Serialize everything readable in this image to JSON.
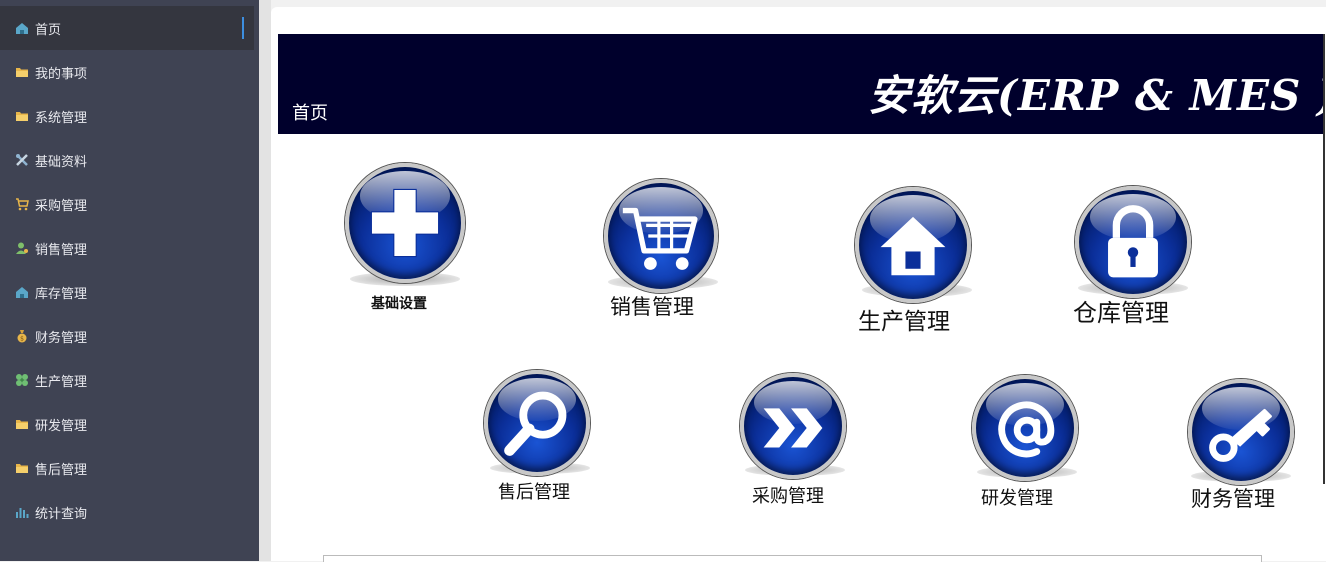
{
  "sidebar": {
    "items": [
      {
        "label": "首页",
        "icon": "home-icon",
        "active": true
      },
      {
        "label": "我的事项",
        "icon": "folder-icon"
      },
      {
        "label": "系统管理",
        "icon": "folder-icon"
      },
      {
        "label": "基础资料",
        "icon": "tools-icon"
      },
      {
        "label": "采购管理",
        "icon": "cart-icon"
      },
      {
        "label": "销售管理",
        "icon": "user-icon"
      },
      {
        "label": "库存管理",
        "icon": "home-icon"
      },
      {
        "label": "财务管理",
        "icon": "money-bag-icon"
      },
      {
        "label": "生产管理",
        "icon": "clover-icon"
      },
      {
        "label": "研发管理",
        "icon": "folder-icon"
      },
      {
        "label": "售后管理",
        "icon": "folder-icon"
      },
      {
        "label": "统计查询",
        "icon": "bar-chart-icon"
      }
    ]
  },
  "banner": {
    "page_title": "首页",
    "brand": "安软云(ERP & MES )"
  },
  "modules": [
    {
      "label": "基础设置",
      "icon": "plus-icon"
    },
    {
      "label": "销售管理",
      "icon": "cart-icon"
    },
    {
      "label": "生产管理",
      "icon": "house-icon"
    },
    {
      "label": "仓库管理",
      "icon": "lock-icon"
    },
    {
      "label": "售后管理",
      "icon": "magnifier-icon"
    },
    {
      "label": "采购管理",
      "icon": "fast-forward-icon"
    },
    {
      "label": "研发管理",
      "icon": "at-sign-icon"
    },
    {
      "label": "财务管理",
      "icon": "key-icon"
    }
  ],
  "colors": {
    "sidebar_bg": "#3f4353",
    "sidebar_active_bg": "#34363f",
    "active_indicator": "#3d8fe0",
    "banner_bg": "#00002c",
    "orb_blue": "#0b2f9a"
  }
}
